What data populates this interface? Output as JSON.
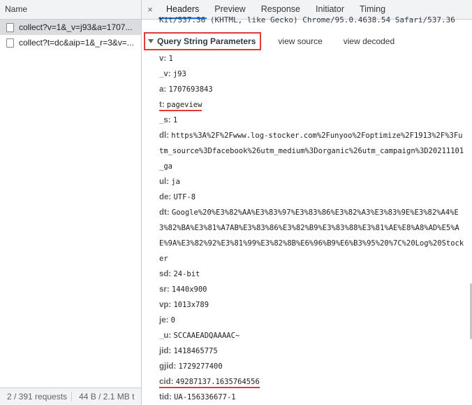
{
  "left_pane": {
    "column_header": "Name",
    "requests": [
      {
        "label": "collect?v=1&_v=j93&a=1707...",
        "selected": true
      },
      {
        "label": "collect?t=dc&aip=1&_r=3&v=...",
        "selected": false
      }
    ],
    "status": {
      "requests": "2 / 391 requests",
      "transferred": "44 B / 2.1 MB t"
    }
  },
  "tabs": {
    "close_glyph": "×",
    "items": [
      "Headers",
      "Preview",
      "Response",
      "Initiator",
      "Timing"
    ],
    "active": "Headers"
  },
  "user_agent_fragment": "Kit/537.36 (KHTML, like Gecko) Chrome/95.0.4638.54 Safari/537.36",
  "section": {
    "title": "Query String Parameters",
    "view_source": "view source",
    "view_decoded": "view decoded"
  },
  "params": [
    {
      "key": "v:",
      "value": "1"
    },
    {
      "key": "_v:",
      "value": "j93"
    },
    {
      "key": "a:",
      "value": "1707693843"
    },
    {
      "key": "t:",
      "value": "pageview"
    },
    {
      "key": "_s:",
      "value": "1"
    },
    {
      "key": "dl:",
      "value": "https%3A%2F%2Fwww.log-stocker.com%2Funyoo%2Foptimize%2F1913%2F%3Futm_source%3Dfacebook%26utm_medium%3Dorganic%26utm_campaign%3D20211101_ga"
    },
    {
      "key": "ul:",
      "value": "ja"
    },
    {
      "key": "de:",
      "value": "UTF-8"
    },
    {
      "key": "dt:",
      "value": "Google%20%E3%82%AA%E3%83%97%E3%83%86%E3%82%A3%E3%83%9E%E3%82%A4%E3%82%BA%E3%81%A7AB%E3%83%86%E3%82%B9%E3%83%88%E3%81%AE%E8%A8%AD%E5%AE%9A%E3%82%92%E3%81%99%E3%82%8B%E6%96%B9%E6%B3%95%20%7C%20Log%20Stocker"
    },
    {
      "key": "sd:",
      "value": "24-bit"
    },
    {
      "key": "sr:",
      "value": "1440x900"
    },
    {
      "key": "vp:",
      "value": "1013x789"
    },
    {
      "key": "je:",
      "value": "0"
    },
    {
      "key": "_u:",
      "value": "SCCAAEADQAAAAC~"
    },
    {
      "key": "jid:",
      "value": "1418465775"
    },
    {
      "key": "gjid:",
      "value": "1729277400"
    },
    {
      "key": "cid:",
      "value": "49287137.1635764556"
    },
    {
      "key": "tid:",
      "value": "UA-156336677-1"
    }
  ],
  "colors": {
    "highlight_red": "#e53935",
    "tab_active_blue": "#1a73e8"
  }
}
